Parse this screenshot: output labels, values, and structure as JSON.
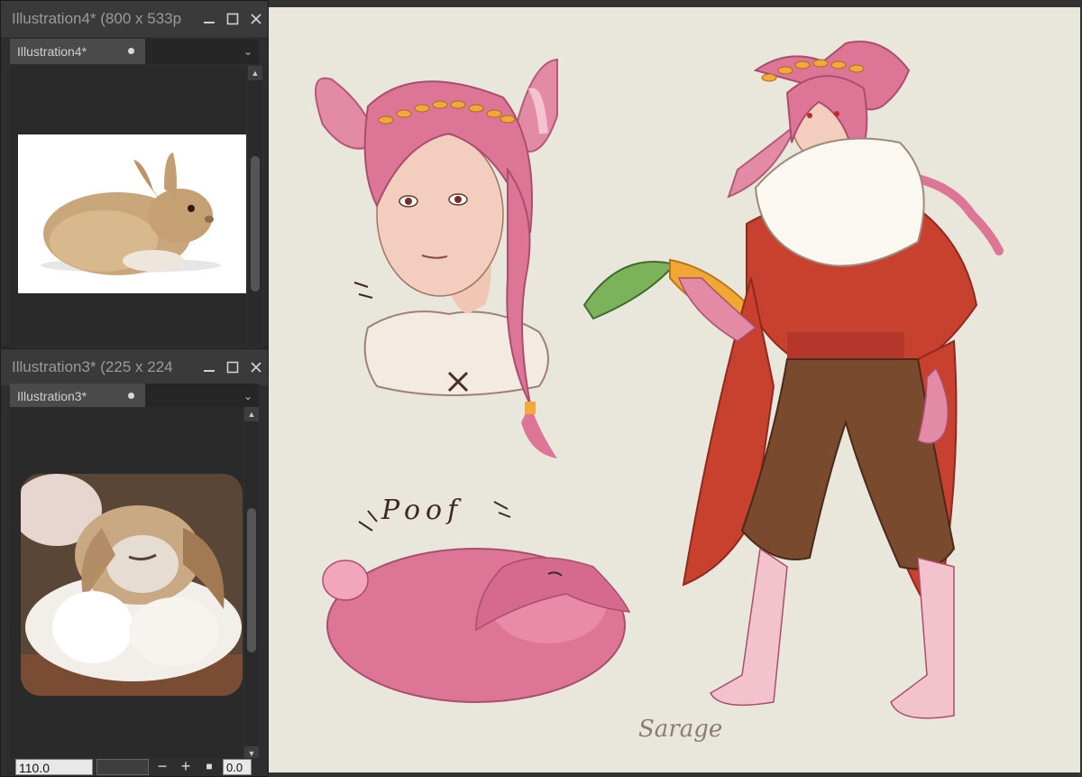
{
  "windows": [
    {
      "title": "Illustration4* (800 x 533p",
      "tab_label": "Illustration4*",
      "image_subject": "brown-rabbit-photo"
    },
    {
      "title": "Illustration3* (225 x 224",
      "tab_label": "Illustration3*",
      "image_subject": "lop-rabbit-photo",
      "zoom": "110.0",
      "rotation": "0.0"
    }
  ],
  "canvas": {
    "poof_text": "Poof",
    "signature": "Sarage",
    "background_color": "#e9e6dc"
  },
  "colors": {
    "panel": "#2e2e2e",
    "titlebar": "#3a3a3a",
    "tab_active": "#4a4a4a",
    "hair_pink": "#d97498",
    "cape_red": "#c8412f",
    "pants_brown": "#7a4a2e",
    "carrot_orange": "#f1a733"
  }
}
